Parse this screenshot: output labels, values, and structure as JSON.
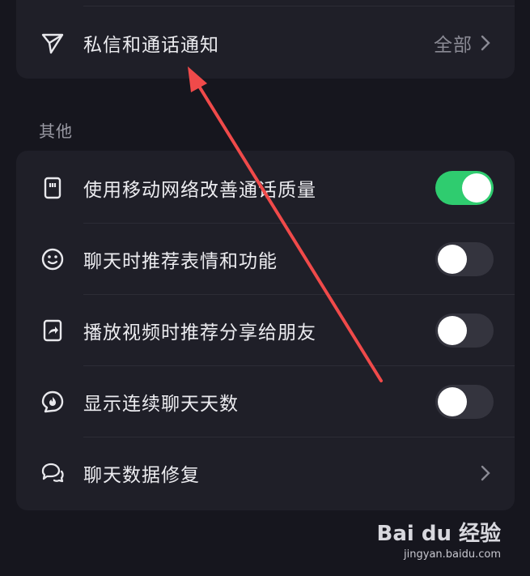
{
  "top_card": {
    "notification_row": {
      "label": "私信和通话通知",
      "value": "全部",
      "icon": "send-icon"
    }
  },
  "other_section": {
    "title": "其他",
    "rows": [
      {
        "label": "使用移动网络改善通话质量",
        "icon": "sim-card-icon",
        "toggle": "on"
      },
      {
        "label": "聊天时推荐表情和功能",
        "icon": "smiley-icon",
        "toggle": "off"
      },
      {
        "label": "播放视频时推荐分享给朋友",
        "icon": "share-icon",
        "toggle": "off"
      },
      {
        "label": "显示连续聊天天数",
        "icon": "flame-icon",
        "toggle": "off"
      },
      {
        "label": "聊天数据修复",
        "icon": "chat-repair-icon",
        "toggle": null
      }
    ]
  },
  "colors": {
    "background": "#16161e",
    "card": "#1f1f28",
    "toggle_on": "#2fcc6f",
    "toggle_off": "#34343e",
    "annotation_arrow": "#f04a4a"
  },
  "watermark": {
    "logo": "Bai du 经验",
    "url": "jingyan.baidu.com"
  }
}
